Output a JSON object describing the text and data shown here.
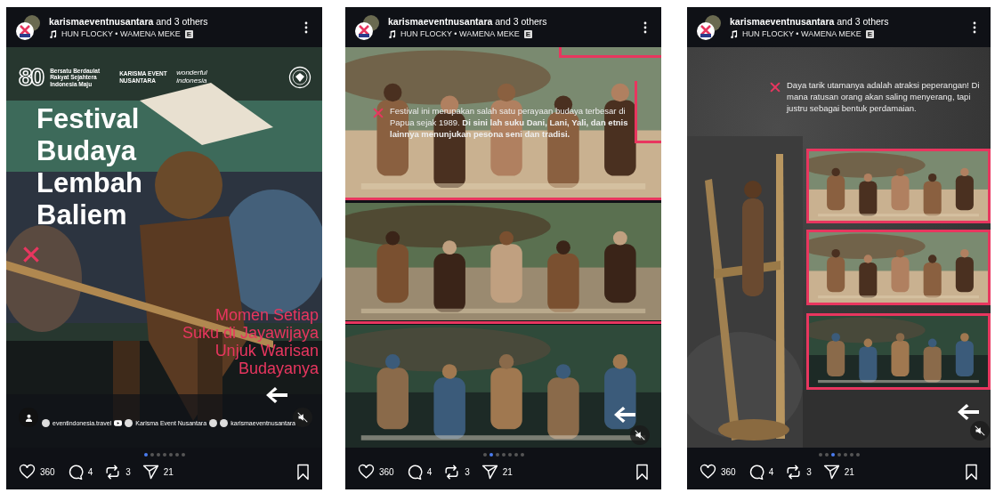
{
  "posts": [
    {
      "header": {
        "author": "karismaeventnusantara",
        "others": "and 3 others",
        "music": "HUN FLOCKY • WAMENA MEKE",
        "explicit": "E"
      },
      "slide": {
        "kind": "cover",
        "badge": "80",
        "tagline": "Bersatu Berdaulat Rakyat Sejahtera Indonesia Maju",
        "brand": "KARISMA EVENT NUSANTARA",
        "tourism": "wonderful indonesia",
        "title": [
          "Festival",
          "Budaya",
          "Lembah",
          "Baliem"
        ],
        "subtitle": [
          "Momen Setiap",
          "Suku di Jayawijaya",
          "Unjuk Warisan",
          "Budayanya"
        ],
        "socials": [
          "eventindonesia.travel",
          "Karisma Event Nusantara",
          "karismaeventnusantara"
        ]
      },
      "dots": [
        {
          "selected": true
        },
        {
          "selected": false
        },
        {
          "selected": false
        },
        {
          "selected": false
        },
        {
          "selected": false
        },
        {
          "selected": false
        },
        {
          "selected": false
        }
      ],
      "stats": {
        "likes": "360",
        "comments": "4",
        "reposts": "3",
        "shares": "21"
      }
    },
    {
      "header": {
        "author": "karismaeventnusantara",
        "others": "and 3 others",
        "music": "HUN FLOCKY • WAMENA MEKE",
        "explicit": "E"
      },
      "slide": {
        "kind": "collage",
        "text": "Festival ini merupakan salah satu perayaan budaya terbesar di Papua sejak 1989. **Di sini lah suku Dani, Lani, Yali, dan etnis lainnya menunjukan pesona seni dan tradisi.**"
      },
      "dots": [
        {
          "selected": false
        },
        {
          "selected": true
        },
        {
          "selected": false
        },
        {
          "selected": false
        },
        {
          "selected": false
        },
        {
          "selected": false
        },
        {
          "selected": false
        }
      ],
      "stats": {
        "likes": "360",
        "comments": "4",
        "reposts": "3",
        "shares": "21"
      }
    },
    {
      "header": {
        "author": "karismaeventnusantara",
        "others": "and 3 others",
        "music": "HUN FLOCKY • WAMENA MEKE",
        "explicit": "E"
      },
      "slide": {
        "kind": "frames",
        "text": "Daya tarik utamanya adalah atraksi peperangan! Di mana ratusan orang akan saling menyerang, tapi justru sebagai bentuk perdamaian."
      },
      "dots": [
        {
          "selected": false
        },
        {
          "selected": false
        },
        {
          "selected": true
        },
        {
          "selected": false
        },
        {
          "selected": false
        },
        {
          "selected": false
        },
        {
          "selected": false
        }
      ],
      "stats": {
        "likes": "360",
        "comments": "4",
        "reposts": "3",
        "shares": "21"
      }
    }
  ]
}
